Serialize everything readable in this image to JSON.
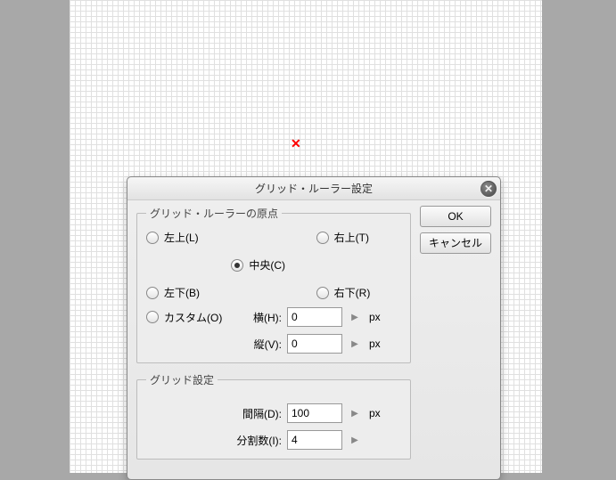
{
  "dialog": {
    "title": "グリッド・ルーラー設定",
    "origin_group": {
      "legend": "グリッド・ルーラーの原点",
      "options": {
        "top_left": "左上(L)",
        "top_right": "右上(T)",
        "center": "中央(C)",
        "bottom_left": "左下(B)",
        "bottom_right": "右下(R)",
        "custom": "カスタム(O)"
      },
      "selected": "center",
      "horizontal_label": "横(H):",
      "horizontal_value": "0",
      "horizontal_unit": "px",
      "vertical_label": "縦(V):",
      "vertical_value": "0",
      "vertical_unit": "px"
    },
    "grid_group": {
      "legend": "グリッド設定",
      "interval_label": "間隔(D):",
      "interval_value": "100",
      "interval_unit": "px",
      "divisions_label": "分割数(I):",
      "divisions_value": "4"
    },
    "buttons": {
      "ok": "OK",
      "cancel": "キャンセル"
    }
  }
}
